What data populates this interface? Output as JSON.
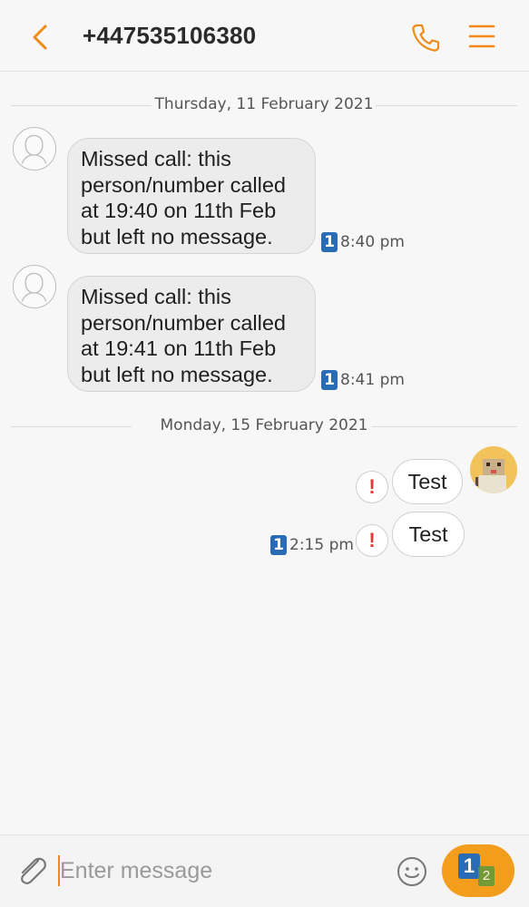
{
  "header": {
    "title": "+447535106380",
    "back_icon": "chevron-left-icon",
    "call_icon": "phone-icon",
    "menu_icon": "menu-icon",
    "accent": "#ef8a17"
  },
  "conversation": {
    "dates": [
      "Thursday, 11 February 2021",
      "Monday, 15 February 2021"
    ],
    "incoming": [
      {
        "lines": [
          "Missed call: this",
          "person/number called",
          "at 19:40 on 11th Feb",
          "but left no message."
        ],
        "sim": "1",
        "time": "8:40 pm"
      },
      {
        "lines": [
          "Missed call: this",
          "person/number called",
          "at 19:41 on 11th Feb",
          "but left no message."
        ],
        "sim": "1",
        "time": "8:41 pm"
      }
    ],
    "outgoing": [
      {
        "text": "Test",
        "status": "!"
      },
      {
        "text": "Test",
        "status": "!",
        "sim": "1",
        "time": "2:15 pm"
      }
    ]
  },
  "composer": {
    "placeholder": "Enter message",
    "value": "",
    "send_sim_primary": "1",
    "send_sim_secondary": "2"
  }
}
